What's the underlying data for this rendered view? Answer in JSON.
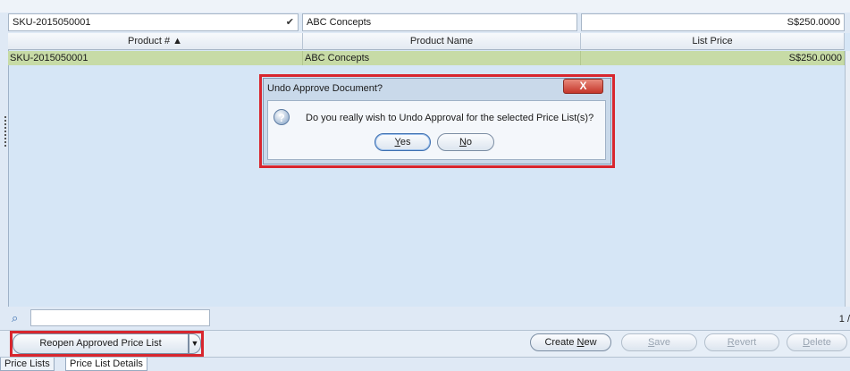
{
  "filter": {
    "sku_value": "SKU-2015050001",
    "product_name_value": "ABC Concepts",
    "price_value": "S$250.0000"
  },
  "grid": {
    "columns": [
      "Product # ▲",
      "Product Name",
      "List Price"
    ],
    "rows": [
      {
        "sku": "SKU-2015050001",
        "name": "ABC Concepts",
        "price": "S$250.0000"
      }
    ]
  },
  "dialog": {
    "title": "Undo Approve Document?",
    "close": "X",
    "message": "Do you really wish to Undo Approval for the selected Price List(s)?",
    "yes_prefix": "",
    "yes_ul": "Y",
    "yes_rest": "es",
    "no_ul": "N",
    "no_rest": "o"
  },
  "search": {
    "placeholder": ""
  },
  "pager": {
    "text": "1 /"
  },
  "toolbar": {
    "reopen": "Reopen Approved Price List",
    "create_prefix": "Create ",
    "create_ul": "N",
    "create_rest": "ew",
    "save_ul": "S",
    "save_rest": "ave",
    "revert_ul": "R",
    "revert_rest": "evert",
    "delete_ul": "D",
    "delete_rest": "elete"
  },
  "tabs": [
    "Price Lists",
    "Price List Details"
  ],
  "icons": {
    "search": "search-icon",
    "question": "question-icon",
    "dropdown": "chevron-down-icon"
  },
  "colors": {
    "selected_row": "#c7dba6",
    "highlight": "#d8262e",
    "grid_bg": "#d6e6f6"
  }
}
